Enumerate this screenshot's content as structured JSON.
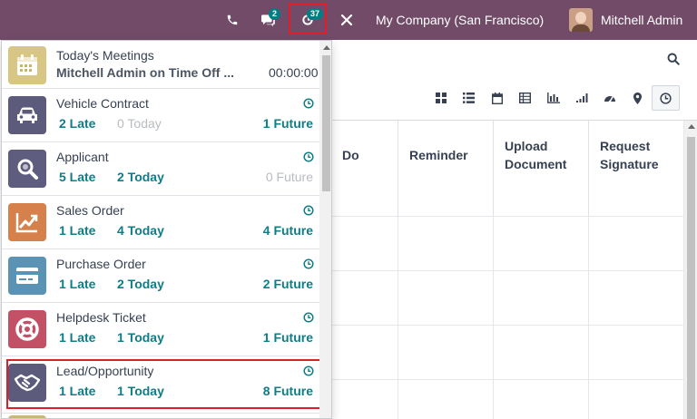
{
  "navbar": {
    "chat_badge": "2",
    "activity_badge": "37",
    "company": "My Company (San Francisco)",
    "user": "Mitchell Admin"
  },
  "table": {
    "headers": [
      "Do",
      "Reminder",
      "Upload Document",
      "Request Signature"
    ]
  },
  "activities": {
    "meeting": {
      "title": "Today's Meetings",
      "subtitle": "Mitchell Admin on Time Off ...",
      "time": "00:00:00"
    },
    "items": [
      {
        "title": "Vehicle Contract",
        "late": "2 Late",
        "today": "0 Today",
        "future": "1 Future"
      },
      {
        "title": "Applicant",
        "late": "5 Late",
        "today": "2 Today",
        "future": "0 Future"
      },
      {
        "title": "Sales Order",
        "late": "1 Late",
        "today": "4 Today",
        "future": "4 Future"
      },
      {
        "title": "Purchase Order",
        "late": "1 Late",
        "today": "2 Today",
        "future": "2 Future"
      },
      {
        "title": "Helpdesk Ticket",
        "late": "1 Late",
        "today": "1 Today",
        "future": "1 Future"
      },
      {
        "title": "Lead/Opportunity",
        "late": "1 Late",
        "today": "1 Today",
        "future": "8 Future"
      }
    ]
  },
  "colors": {
    "navbar": "#714B67",
    "accent_teal": "#0f7c86",
    "highlight": "#e11d28"
  },
  "icons": [
    "phone-icon",
    "chat-icon",
    "clock-icon",
    "close-icon",
    "search-icon",
    "kanban-icon",
    "list-icon",
    "calendar-icon",
    "pivot-icon",
    "graph-icon",
    "cohort-icon",
    "dashboard-icon",
    "map-marker-icon",
    "activity-icon"
  ]
}
